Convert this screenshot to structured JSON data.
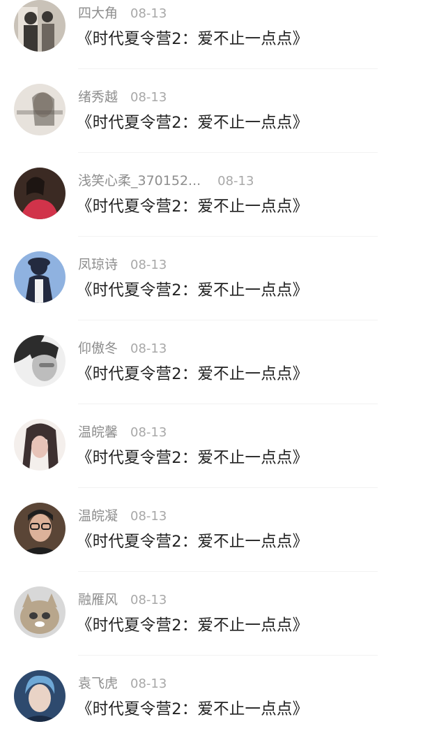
{
  "comments": [
    {
      "username": "四大角",
      "date": "08-13",
      "text": "《时代夏令营2：爱不止一点点》"
    },
    {
      "username": "绪秀越",
      "date": "08-13",
      "text": "《时代夏令营2：爱不止一点点》"
    },
    {
      "username": "浅笑心柔_370152...",
      "date": "08-13",
      "text": "《时代夏令营2：爱不止一点点》"
    },
    {
      "username": "凤琼诗",
      "date": "08-13",
      "text": "《时代夏令营2：爱不止一点点》"
    },
    {
      "username": "仰傲冬",
      "date": "08-13",
      "text": "《时代夏令营2：爱不止一点点》"
    },
    {
      "username": "温皖馨",
      "date": "08-13",
      "text": "《时代夏令营2：爱不止一点点》"
    },
    {
      "username": "温皖凝",
      "date": "08-13",
      "text": "《时代夏令营2：爱不止一点点》"
    },
    {
      "username": "融雁风",
      "date": "08-13",
      "text": "《时代夏令营2：爱不止一点点》"
    },
    {
      "username": "袁飞虎",
      "date": "08-13",
      "text": "《时代夏令营2：爱不止一点点》"
    }
  ],
  "avatars": [
    {
      "bg": "#c9c2b8",
      "fg": "#3a3734",
      "accent": "#e8e2da"
    },
    {
      "bg": "#e7e2dc",
      "fg": "#5a534c",
      "accent": "#b9aea3"
    },
    {
      "bg": "#3b2a23",
      "fg": "#d1334a",
      "accent": "#f0cdb9"
    },
    {
      "bg": "#8fb2e0",
      "fg": "#232a3f",
      "accent": "#f2f2f2"
    },
    {
      "bg": "#2c2c2c",
      "fg": "#bdbdbd",
      "accent": "#efefef"
    },
    {
      "bg": "#f4efec",
      "fg": "#3d3030",
      "accent": "#e7c3b8"
    },
    {
      "bg": "#5a4536",
      "fg": "#1e1e1e",
      "accent": "#dcb29a"
    },
    {
      "bg": "#d8d8d8",
      "fg": "#b8a68c",
      "accent": "#ffffff"
    },
    {
      "bg": "#2e4a6e",
      "fg": "#6ea8d6",
      "accent": "#e9d3c6"
    }
  ]
}
